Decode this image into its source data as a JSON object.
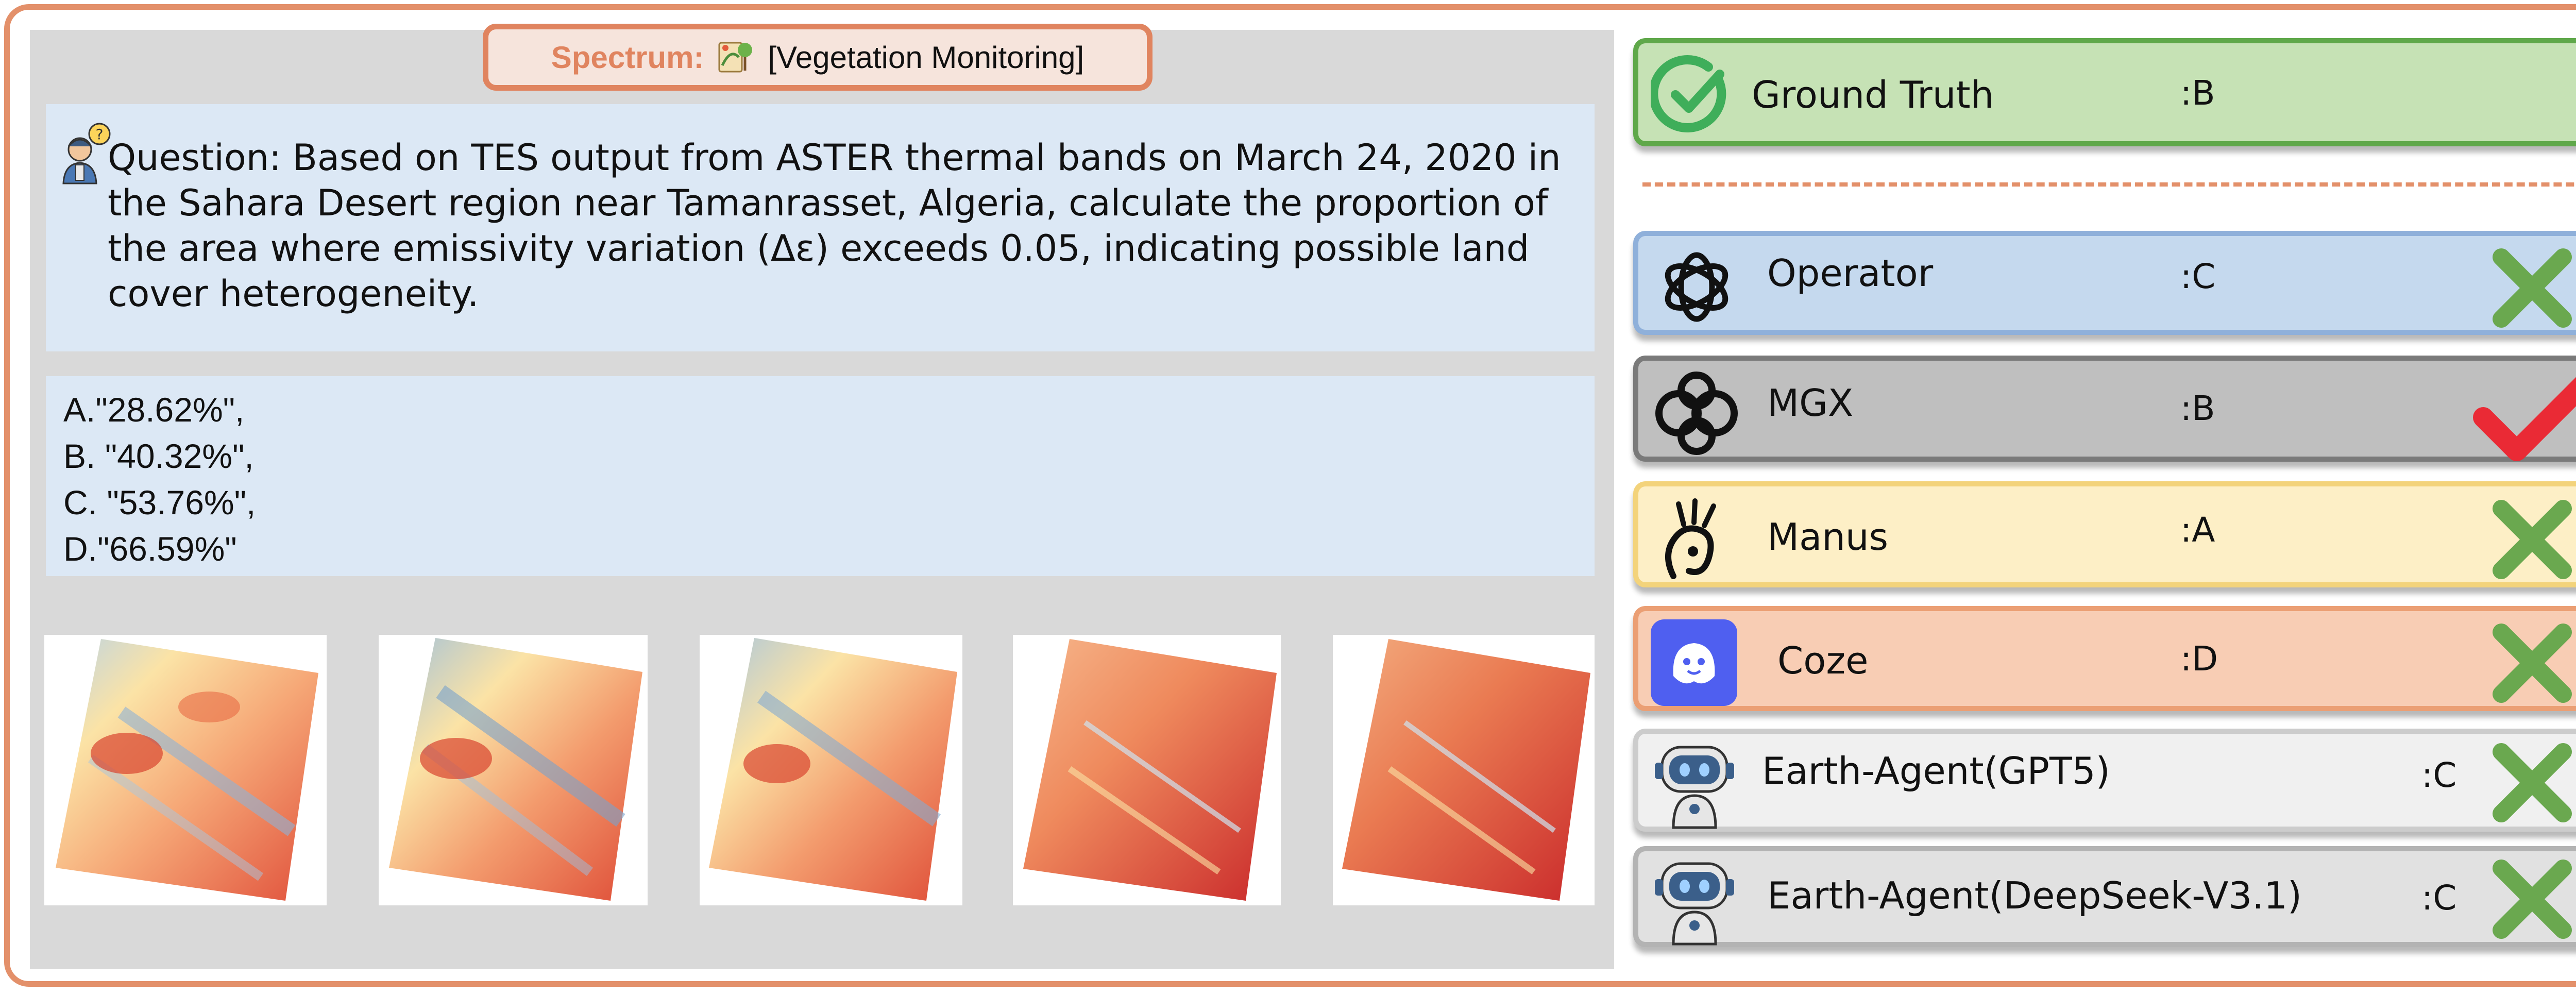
{
  "spectrum": {
    "label": "Spectrum:",
    "value": "[Vegetation Monitoring]",
    "icon": "vegetation-icon"
  },
  "question": {
    "icon": "person-question-icon",
    "text": "Question: Based on TES output from ASTER thermal bands on March 24, 2020 in the Sahara Desert region near Tamanrasset, Algeria, calculate the proportion of the area where emissivity variation (Δε) exceeds 0.05, indicating possible land cover heterogeneity."
  },
  "options": [
    "A.\"28.62%\",",
    "B. \"40.32%\",",
    "C. \"53.76%\",",
    "D.\"66.59%\""
  ],
  "images": {
    "count": 5,
    "colormap": [
      "#3f6fb0",
      "#cfe3ef",
      "#fbe3a6",
      "#f08a5b",
      "#c9282a"
    ]
  },
  "ground_truth": {
    "label": "Ground Truth",
    "answer": ":B",
    "icon": "check-circle-icon",
    "color": "#5fa84a"
  },
  "agents": [
    {
      "name": "Operator",
      "answer": ":C",
      "icon": "openai-logo-icon",
      "result": "wrong",
      "bg": "#c5d9ee",
      "border": "#8fb0da"
    },
    {
      "name": "MGX",
      "answer": ":B",
      "icon": "mgx-logo-icon",
      "result": "correct",
      "bg": "#bfbfbf",
      "border": "#7a7a7a"
    },
    {
      "name": "Manus",
      "answer": ":A",
      "icon": "manus-logo-icon",
      "result": "wrong",
      "bg": "#fdefc6",
      "border": "#f3d37b"
    },
    {
      "name": "Coze",
      "answer": ":D",
      "icon": "coze-logo-icon",
      "result": "wrong",
      "bg": "#f8cdb4",
      "border": "#eb9f74"
    },
    {
      "name": "Earth-Agent(GPT5)",
      "answer": ":C",
      "icon": "robot-icon",
      "result": "wrong",
      "bg": "#f0f0f0",
      "border": "#cccccc"
    },
    {
      "name": "Earth-Agent(DeepSeek-V3.1)",
      "answer": ":C",
      "icon": "robot-icon",
      "result": "wrong",
      "bg": "#e1e1e1",
      "border": "#b3b3b3"
    }
  ],
  "colors": {
    "wrong_mark": "#6aa84f",
    "correct_mark": "#ea2a35",
    "frame": "#e3906a"
  }
}
